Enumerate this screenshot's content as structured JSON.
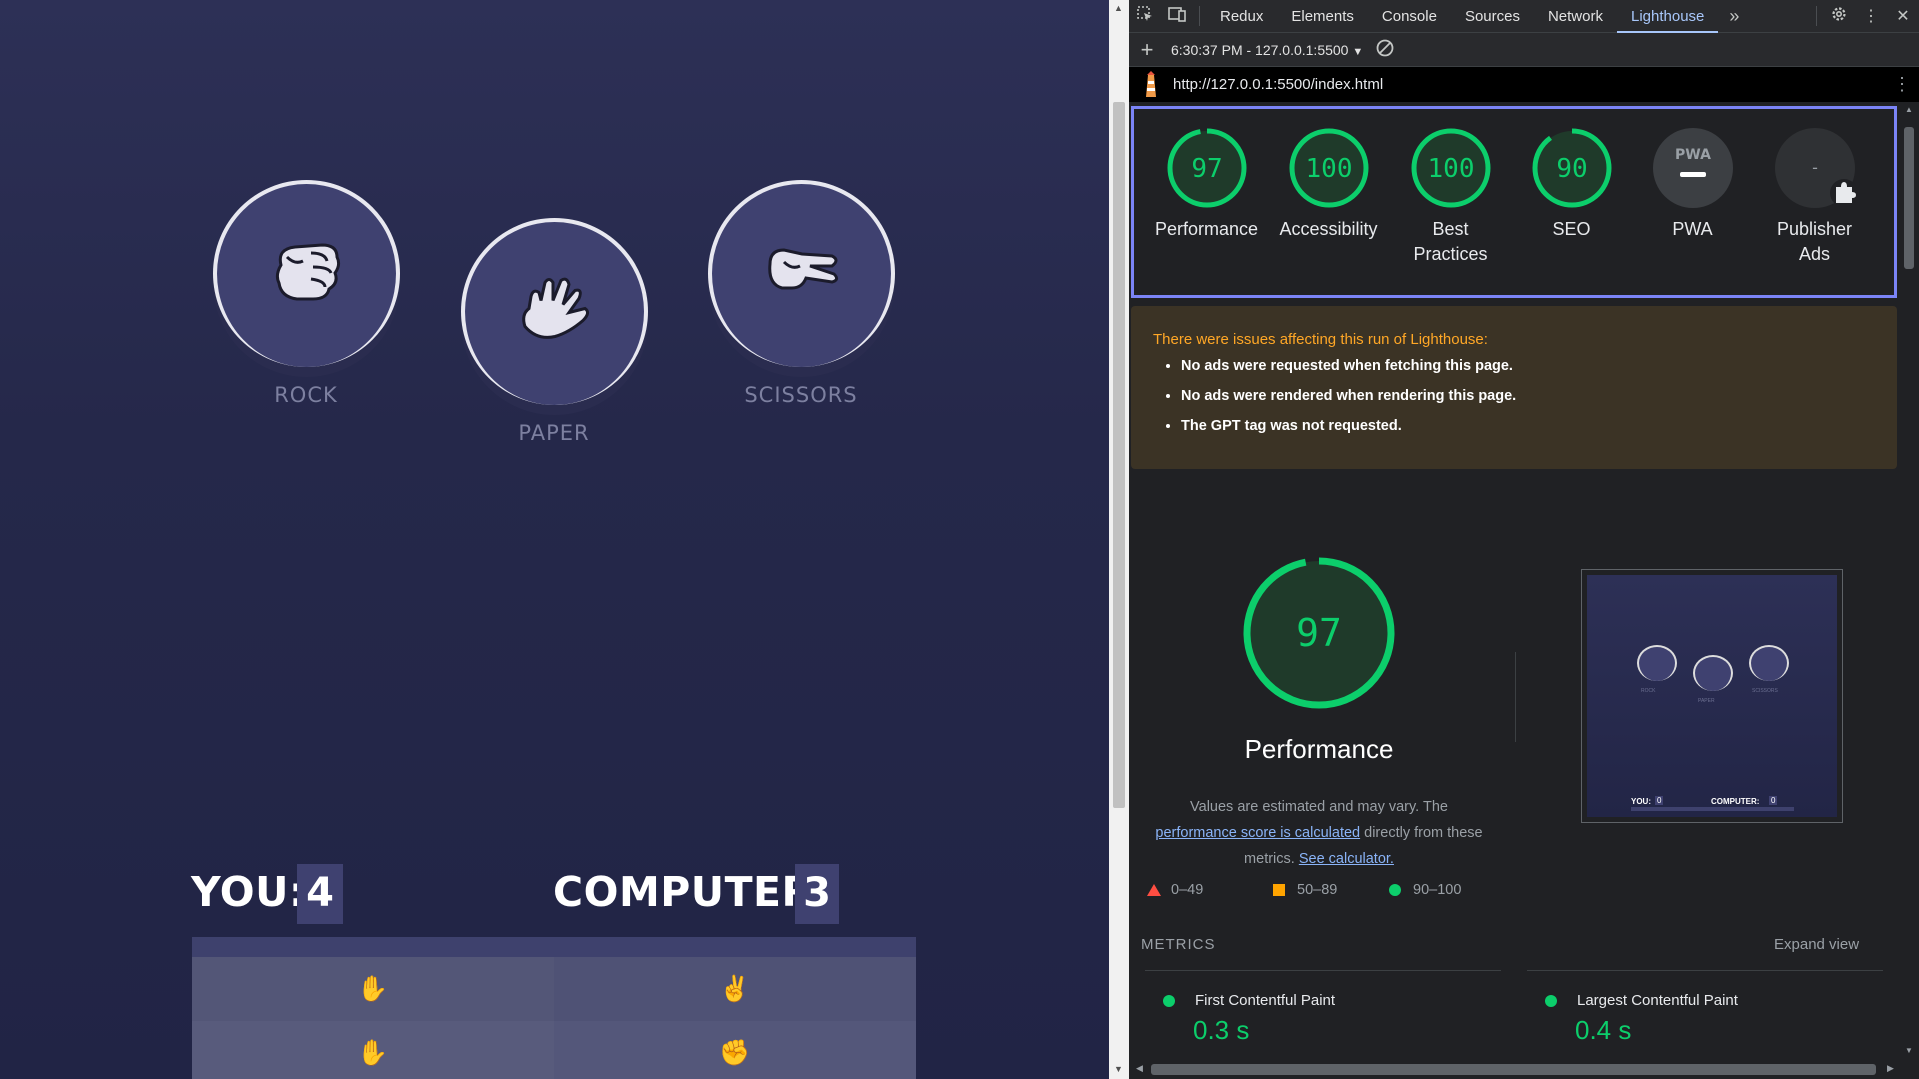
{
  "game": {
    "choices": [
      {
        "label": "ROCK",
        "icon": "rock-hand-icon"
      },
      {
        "label": "PAPER",
        "icon": "paper-hand-icon"
      },
      {
        "label": "SCISSORS",
        "icon": "scissors-hand-icon"
      }
    ],
    "score": {
      "you_label": "YOU:",
      "you_value": "4",
      "computer_label": "COMPUTER:",
      "computer_value": "3"
    },
    "history": [
      {
        "you": "✋",
        "computer": "✌"
      },
      {
        "you": "✋",
        "computer": "✊"
      }
    ]
  },
  "devtools": {
    "tabs": [
      "Redux",
      "Elements",
      "Console",
      "Sources",
      "Network",
      "Lighthouse"
    ],
    "active_tab": "Lighthouse",
    "toolbar": {
      "report_selector": "6:30:37 PM - 127.0.0.1:5500"
    },
    "url": "http://127.0.0.1:5500/index.html",
    "gauges": [
      {
        "score": "97",
        "label": "Performance",
        "color": "#0cce6b"
      },
      {
        "score": "100",
        "label": "Accessibility",
        "color": "#0cce6b"
      },
      {
        "score": "100",
        "label": "Best Practices",
        "color": "#0cce6b"
      },
      {
        "score": "90",
        "label": "SEO",
        "color": "#0cce6b"
      },
      {
        "score": "",
        "label": "PWA",
        "badge": "PWA"
      },
      {
        "score": "-",
        "label": "Publisher Ads"
      }
    ],
    "issues": {
      "title": "There were issues affecting this run of Lighthouse:",
      "items": [
        "No ads were requested when fetching this page.",
        "No ads were rendered when rendering this page.",
        "The GPT tag was not requested."
      ]
    },
    "performance": {
      "score": "97",
      "title": "Performance",
      "desc_1": "Values are estimated and may vary. The",
      "link_1": "performance score is calculated",
      "desc_2": "directly from these",
      "desc_3": "metrics.",
      "link_2": "See calculator.",
      "legend": [
        "0–49",
        "50–89",
        "90–100"
      ],
      "thumbnail": {
        "labels": [
          "ROCK",
          "PAPER",
          "SCISSORS"
        ],
        "you": "YOU:",
        "you_value": "0",
        "computer": "COMPUTER:",
        "computer_value": "0"
      }
    },
    "metrics": {
      "header": "METRICS",
      "expand": "Expand view",
      "items": [
        {
          "name": "First Contentful Paint",
          "value": "0.3 s"
        },
        {
          "name": "Largest Contentful Paint",
          "value": "0.4 s"
        }
      ]
    },
    "colors": {
      "pass": "#0cce6b",
      "average": "#ffa400",
      "fail": "#ff4e42",
      "accent": "#7b84f6"
    }
  }
}
